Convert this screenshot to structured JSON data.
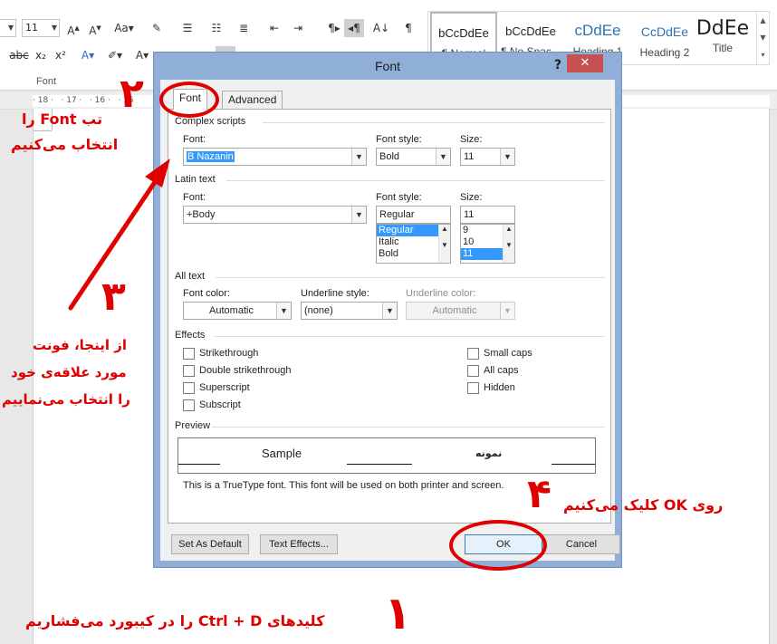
{
  "ribbon": {
    "font_size_value": "11",
    "style_cards": [
      {
        "sample": "bCcDdEe",
        "name": "¶ Normal"
      },
      {
        "sample": "bCcDdEe",
        "name": "¶ No Spac..."
      },
      {
        "sample": "cDdEe",
        "name": "Heading 1"
      },
      {
        "sample": "CcDdEe",
        "name": "Heading 2"
      },
      {
        "sample": "DdEe",
        "name": "Title"
      }
    ],
    "font_group_label": "Font",
    "ruler_text": "· 18 ·   · 17 ·   · 16 ·   · 15",
    "colors": {
      "accent_red": "#e00000",
      "title_blue": "#8faed8",
      "selection": "#3399ff"
    }
  },
  "dialog": {
    "title": "Font",
    "help": "?",
    "close": "✕",
    "tabs": [
      "Font",
      "Advanced"
    ],
    "complex_scripts": {
      "section": "Complex scripts",
      "font_label": "Font:",
      "font_value": "B Nazanin",
      "style_label": "Font style:",
      "style_value": "Bold",
      "size_label": "Size:",
      "size_value": "11"
    },
    "latin_text": {
      "section": "Latin text",
      "font_label": "Font:",
      "font_value": "+Body",
      "style_label": "Font style:",
      "style_value": "Regular",
      "style_options": [
        "Regular",
        "Italic",
        "Bold"
      ],
      "size_label": "Size:",
      "size_value": "11",
      "size_options": [
        "9",
        "10",
        "11"
      ]
    },
    "all_text": {
      "section": "All text",
      "color_label": "Font color:",
      "color_value": "Automatic",
      "underline_label": "Underline style:",
      "underline_value": "(none)",
      "underline_color_label": "Underline color:",
      "underline_color_value": "Automatic"
    },
    "effects": {
      "section": "Effects",
      "left": [
        "Strikethrough",
        "Double strikethrough",
        "Superscript",
        "Subscript"
      ],
      "right": [
        "Small caps",
        "All caps",
        "Hidden"
      ]
    },
    "preview": {
      "section": "Preview",
      "sample": "Sample",
      "sample_fa": "نمونه",
      "note": "This is a TrueType font. This font will be used on both printer and screen."
    },
    "buttons": {
      "set_default": "Set As Default",
      "text_effects": "Text Effects...",
      "ok": "OK",
      "cancel": "Cancel"
    }
  },
  "annotations": {
    "step1_num": "۱",
    "step1_text": "کلیدهای Ctrl + D را در کیبورد می‌فشاریم",
    "step2_num": "۲",
    "step2_line1": "تب Font را",
    "step2_line2": "انتخاب می‌کنیم",
    "step3_num": "۳",
    "step3_line1": "از اینجا، فونت",
    "step3_line2": "مورد علاقه‌ی خود",
    "step3_line3": "را انتخاب می‌نماییم",
    "step4_num": "۴",
    "step4_text": "روی OK کلیک می‌کنیم"
  }
}
